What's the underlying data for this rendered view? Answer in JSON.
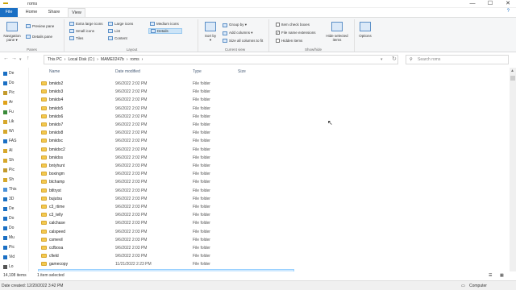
{
  "window": {
    "title": "roms",
    "minimize": "—",
    "maximize": "☐",
    "close": "✕"
  },
  "tabs": {
    "file": "File",
    "home": "Home",
    "share": "Share",
    "view": "View"
  },
  "ribbon": {
    "panes": {
      "navigation_pane": "Navigation pane ▾",
      "preview_pane": "Preview pane",
      "details_pane": "Details pane",
      "caption": "Panes"
    },
    "layout": {
      "extra_large": "Extra large icons",
      "large": "Large icons",
      "medium": "Medium icons",
      "small": "Small icons",
      "list": "List",
      "details": "Details",
      "tiles": "Tiles",
      "content": "Content",
      "caption": "Layout"
    },
    "current_view": {
      "sort_by": "Sort by ▾",
      "group_by": "Group by ▾",
      "add_columns": "Add columns ▾",
      "size_all": "Size all columns to fit",
      "caption": "Current view"
    },
    "show_hide": {
      "item_check_boxes": "Item check boxes",
      "file_name_extensions": "File name extensions",
      "hidden_items": "Hidden items",
      "hide_selected": "Hide selected items",
      "caption": "Show/hide"
    },
    "options": "Options"
  },
  "address": {
    "segments": [
      "This PC",
      "Local Disk (C:)",
      "MAME0247b",
      "roms"
    ],
    "search_placeholder": "Search roms"
  },
  "nav_pane": [
    "De",
    "Do",
    "Pic",
    "Ar",
    "Fu",
    "Lik",
    "Wi",
    "FAS",
    "Al",
    "Sh",
    "Pic",
    "Sh",
    "This",
    "3D",
    "De",
    "Do",
    "Do",
    "Mu",
    "Pic",
    "Vid",
    "Lo"
  ],
  "columns": {
    "name": "Name",
    "date": "Date modified",
    "type": "Type",
    "size": "Size"
  },
  "files": [
    {
      "name": "bmiidx2",
      "date": "9/6/2022 2:02 PM",
      "type": "File folder"
    },
    {
      "name": "bmiidx3",
      "date": "9/6/2022 2:02 PM",
      "type": "File folder"
    },
    {
      "name": "bmiidx4",
      "date": "9/6/2022 2:02 PM",
      "type": "File folder"
    },
    {
      "name": "bmiidx5",
      "date": "9/6/2022 2:02 PM",
      "type": "File folder"
    },
    {
      "name": "bmiidx6",
      "date": "9/6/2022 2:02 PM",
      "type": "File folder"
    },
    {
      "name": "bmiidx7",
      "date": "9/6/2022 2:02 PM",
      "type": "File folder"
    },
    {
      "name": "bmiidx8",
      "date": "9/6/2022 2:02 PM",
      "type": "File folder"
    },
    {
      "name": "bmiidxc",
      "date": "9/6/2022 2:02 PM",
      "type": "File folder"
    },
    {
      "name": "bmiidxc2",
      "date": "9/6/2022 2:02 PM",
      "type": "File folder"
    },
    {
      "name": "bmiidxs",
      "date": "9/6/2022 2:02 PM",
      "type": "File folder"
    },
    {
      "name": "bntyhunt",
      "date": "9/6/2022 2:03 PM",
      "type": "File folder"
    },
    {
      "name": "boxingm",
      "date": "9/6/2022 2:03 PM",
      "type": "File folder"
    },
    {
      "name": "btchamp",
      "date": "9/6/2022 2:03 PM",
      "type": "File folder"
    },
    {
      "name": "btltryst",
      "date": "9/6/2022 2:03 PM",
      "type": "File folder"
    },
    {
      "name": "bujutsu",
      "date": "9/6/2022 2:03 PM",
      "type": "File folder"
    },
    {
      "name": "c3_rtime",
      "date": "9/6/2022 2:03 PM",
      "type": "File folder"
    },
    {
      "name": "c3_telly",
      "date": "9/6/2022 2:03 PM",
      "type": "File folder"
    },
    {
      "name": "calchase",
      "date": "9/6/2022 2:03 PM",
      "type": "File folder"
    },
    {
      "name": "calspeed",
      "date": "9/6/2022 2:03 PM",
      "type": "File folder"
    },
    {
      "name": "csmevil",
      "date": "9/6/2022 2:03 PM",
      "type": "File folder"
    },
    {
      "name": "ccfboxa",
      "date": "9/6/2022 2:03 PM",
      "type": "File folder"
    },
    {
      "name": "cfield",
      "date": "9/6/2022 2:03 PM",
      "type": "File folder"
    },
    {
      "name": "gamecopy",
      "date": "11/21/2022 2:23 PM",
      "type": "File folder"
    },
    {
      "name": "Driving",
      "date": "12/20/2022 3:42 PM",
      "type": "File folder",
      "selected": true
    }
  ],
  "status": {
    "count": "14,108 items",
    "selected": "1 item selected"
  },
  "info": {
    "date_created": "Date created: 12/20/2022 3:42 PM",
    "computer": "Computer"
  }
}
